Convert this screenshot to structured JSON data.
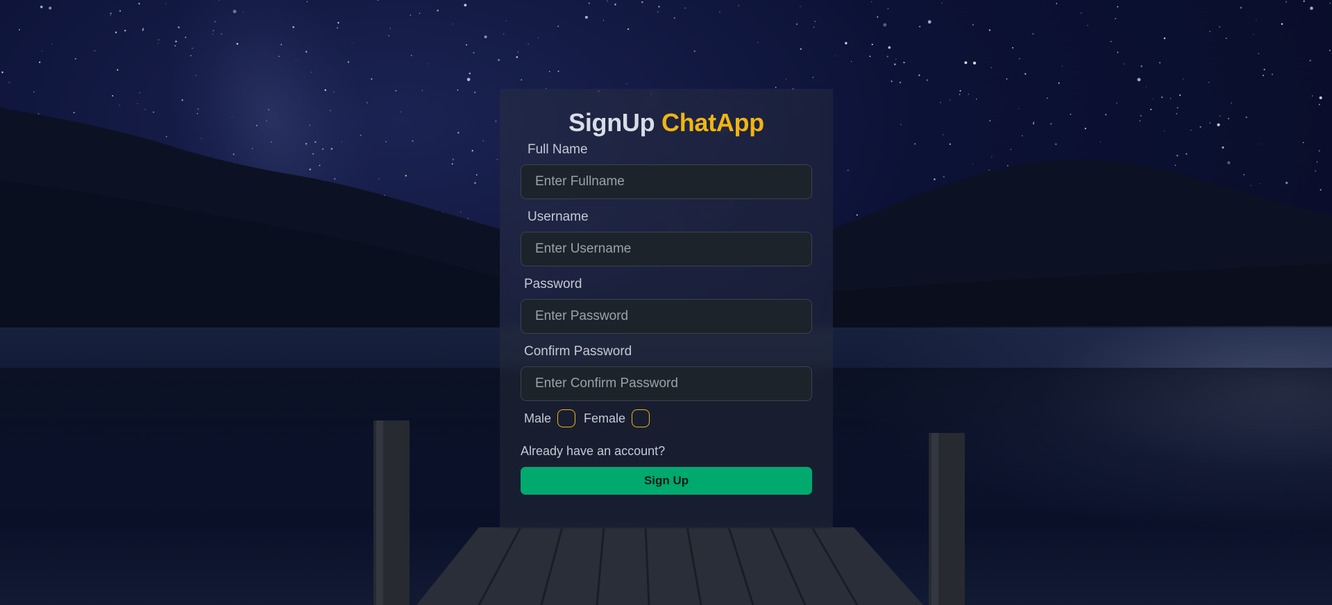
{
  "title": {
    "main": "SignUp",
    "brand": "ChatApp"
  },
  "form": {
    "full_name": {
      "label": "Full Name",
      "placeholder": "Enter Fullname"
    },
    "username": {
      "label": "Username",
      "placeholder": "Enter Username"
    },
    "password": {
      "label": "Password",
      "placeholder": "Enter Password"
    },
    "confirm_password": {
      "label": "Confirm Password",
      "placeholder": "Enter Confirm Password"
    },
    "gender": {
      "male_label": "Male",
      "female_label": "Female"
    },
    "login_link": "Already have an account?",
    "submit_label": "Sign Up"
  },
  "colors": {
    "brand": "#f1b511",
    "button": "#00a96e",
    "card": "rgba(48,52,62,0.38)",
    "input_bg": "#1d232a"
  }
}
